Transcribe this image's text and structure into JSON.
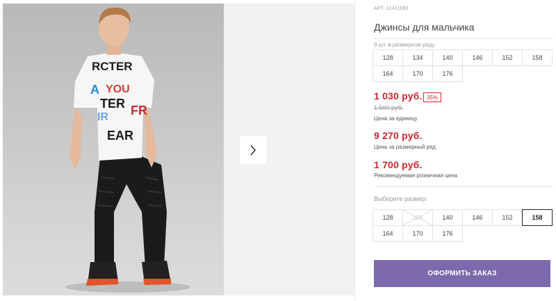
{
  "product": {
    "sku": "АРТ. 12411093",
    "title": "Джинсы для мальчика",
    "pack_note": "9 шт. в размерном ряду",
    "pack_sizes": [
      "128",
      "134",
      "140",
      "146",
      "152",
      "158",
      "164",
      "170",
      "176"
    ]
  },
  "pricing": {
    "unit_price": "1 030 руб.",
    "discount": "35%",
    "old_price": "1 590 руб.",
    "unit_label": "Цена за единицу",
    "pack_price": "9 270 руб.",
    "pack_label": "Цена за размерный ряд",
    "retail_price": "1 700 руб.",
    "retail_label": "Рекомендуемая розничная цена"
  },
  "size_picker": {
    "label": "Выберите размер:",
    "sizes": [
      {
        "label": "128",
        "state": "available"
      },
      {
        "label": "134",
        "state": "disabled"
      },
      {
        "label": "140",
        "state": "available"
      },
      {
        "label": "146",
        "state": "available"
      },
      {
        "label": "152",
        "state": "available"
      },
      {
        "label": "158",
        "state": "selected"
      },
      {
        "label": "164",
        "state": "available"
      },
      {
        "label": "170",
        "state": "available"
      },
      {
        "label": "176",
        "state": "available"
      }
    ]
  },
  "order_button": "ОФОРМИТЬ ЗАКАЗ",
  "gallery": {
    "next_icon": "chevron-right-icon"
  },
  "colors": {
    "accent": "#7c6aac",
    "price": "#d0242d"
  }
}
